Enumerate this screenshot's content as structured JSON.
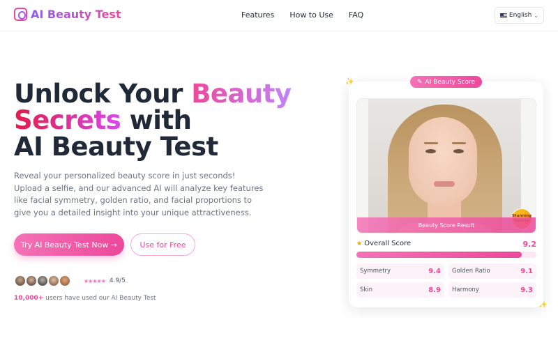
{
  "brand": {
    "name": "AI Beauty Test"
  },
  "nav": {
    "links": [
      "Features",
      "How to Use",
      "FAQ"
    ],
    "language": "English"
  },
  "hero": {
    "headline_part1": "Unlock Your ",
    "headline_part2": "Beauty",
    "headline_part3": "Secrets",
    "headline_part4": " with",
    "headline_part5": "AI Beauty Test",
    "description": "Reveal your personalized beauty score in just seconds! Upload a selfie, and our advanced AI will analyze key features like facial symmetry, golden ratio, and facial proportions to give you a detailed insight into your unique attractiveness.",
    "primary_button": "Try AI Beauty Test Now →",
    "secondary_button": "Use for Free",
    "rating": "4.9/5",
    "users_count": "10,000+",
    "users_text": " users have used our AI Beauty Test"
  },
  "score_card": {
    "pill_label": "AI Beauty Score",
    "photo_caption": "Beauty Score Result",
    "badge": "Stunning Beauty",
    "overall_label": "Overall Score",
    "overall_value": "9.2",
    "overall_fraction": 0.92,
    "metrics": [
      {
        "label": "Symmetry",
        "value": "9.4"
      },
      {
        "label": "Golden Ratio",
        "value": "9.1"
      },
      {
        "label": "Skin",
        "value": "8.9"
      },
      {
        "label": "Harmony",
        "value": "9.3"
      }
    ]
  },
  "colors": {
    "accent": "#ec4899",
    "accent_light": "#f472b6",
    "brand_purple": "#8b5cf6"
  }
}
